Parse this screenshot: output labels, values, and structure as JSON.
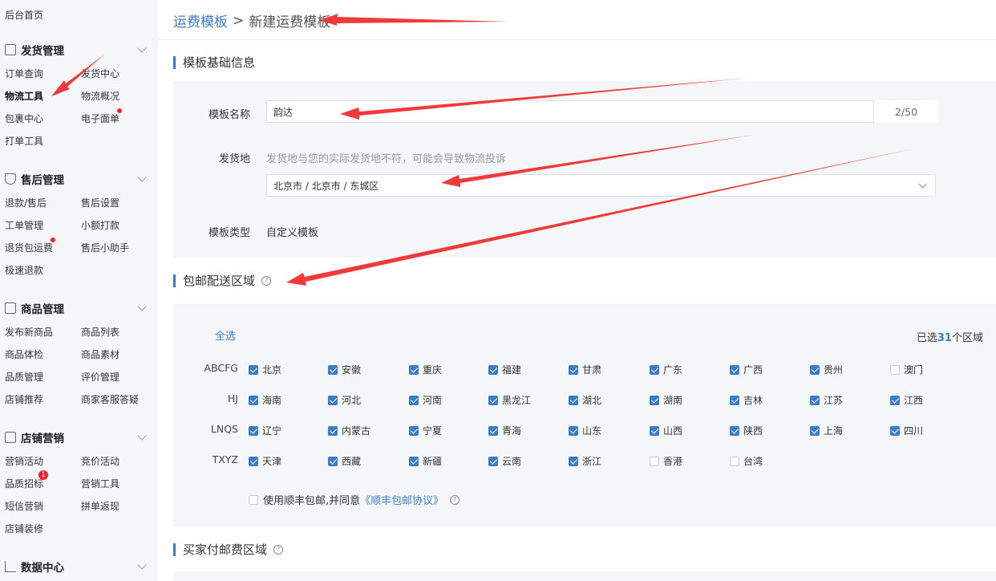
{
  "sidebar": {
    "home": "后台首页",
    "groups": [
      {
        "title": "发货管理",
        "icon": "document-icon",
        "items": [
          "订单查询",
          "发货中心",
          "物流工具",
          "物流概况",
          "包裹中心",
          "电子面单",
          "打单工具"
        ]
      },
      {
        "title": "售后管理",
        "icon": "shield-icon",
        "items": [
          "退款/售后",
          "售后设置",
          "工单管理",
          "小额打款",
          "退货包运费",
          "售后小助手",
          "极速退款"
        ]
      },
      {
        "title": "商品管理",
        "icon": "bag-icon",
        "items": [
          "发布新商品",
          "商品列表",
          "商品体检",
          "商品素材",
          "品质管理",
          "评价管理",
          "店铺推荐",
          "商家客服答疑"
        ]
      },
      {
        "title": "店铺营销",
        "icon": "store-icon",
        "items": [
          "营销活动",
          "竞价活动",
          "品质招标",
          "营销工具",
          "短信营销",
          "拼单返现",
          "店铺装修"
        ]
      },
      {
        "title": "数据中心",
        "icon": "bar-chart-icon",
        "items": []
      }
    ],
    "badge_count": "1"
  },
  "breadcrumb": {
    "parent": "运费模板",
    "separator": ">",
    "current": "新建运费模板"
  },
  "basic": {
    "title": "模板基础信息",
    "name_label": "模板名称",
    "name_value": "韵达",
    "name_counter": "2/50",
    "origin_label": "发货地",
    "origin_hint": "发货地与您的实际发货地不符，可能会导致物流投诉",
    "origin_value": "北京市 / 北京市 / 东城区",
    "type_label": "模板类型",
    "type_value": "自定义模板"
  },
  "free_shipping": {
    "title": "包邮配送区域",
    "select_all": "全选",
    "selected_prefix": "已选",
    "selected_count": "31",
    "selected_suffix": "个区域",
    "rows": [
      {
        "label": "ABCFG",
        "regions": [
          [
            "北京",
            true
          ],
          [
            "安徽",
            true
          ],
          [
            "重庆",
            true
          ],
          [
            "福建",
            true
          ],
          [
            "甘肃",
            true
          ],
          [
            "广东",
            true
          ],
          [
            "广西",
            true
          ],
          [
            "贵州",
            true
          ],
          [
            "澳门",
            false
          ]
        ]
      },
      {
        "label": "HJ",
        "regions": [
          [
            "海南",
            true
          ],
          [
            "河北",
            true
          ],
          [
            "河南",
            true
          ],
          [
            "黑龙江",
            true
          ],
          [
            "湖北",
            true
          ],
          [
            "湖南",
            true
          ],
          [
            "吉林",
            true
          ],
          [
            "江苏",
            true
          ],
          [
            "江西",
            true
          ]
        ]
      },
      {
        "label": "LNQS",
        "regions": [
          [
            "辽宁",
            true
          ],
          [
            "内蒙古",
            true
          ],
          [
            "宁夏",
            true
          ],
          [
            "青海",
            true
          ],
          [
            "山东",
            true
          ],
          [
            "山西",
            true
          ],
          [
            "陕西",
            true
          ],
          [
            "上海",
            true
          ],
          [
            "四川",
            true
          ]
        ]
      },
      {
        "label": "TXYZ",
        "regions": [
          [
            "天津",
            true
          ],
          [
            "西藏",
            true
          ],
          [
            "新疆",
            true
          ],
          [
            "云南",
            true
          ],
          [
            "浙江",
            true
          ],
          [
            "香港",
            false
          ],
          [
            "台湾",
            false
          ]
        ]
      }
    ],
    "sf_text": "使用顺丰包邮,并同意",
    "sf_link": "《顺丰包邮协议》"
  },
  "buyer_pays": {
    "title": "买家付邮费区域"
  },
  "colors": {
    "accent": "#3b7cc9",
    "arrow": "#f03a3a",
    "badge": "#f5222d"
  }
}
